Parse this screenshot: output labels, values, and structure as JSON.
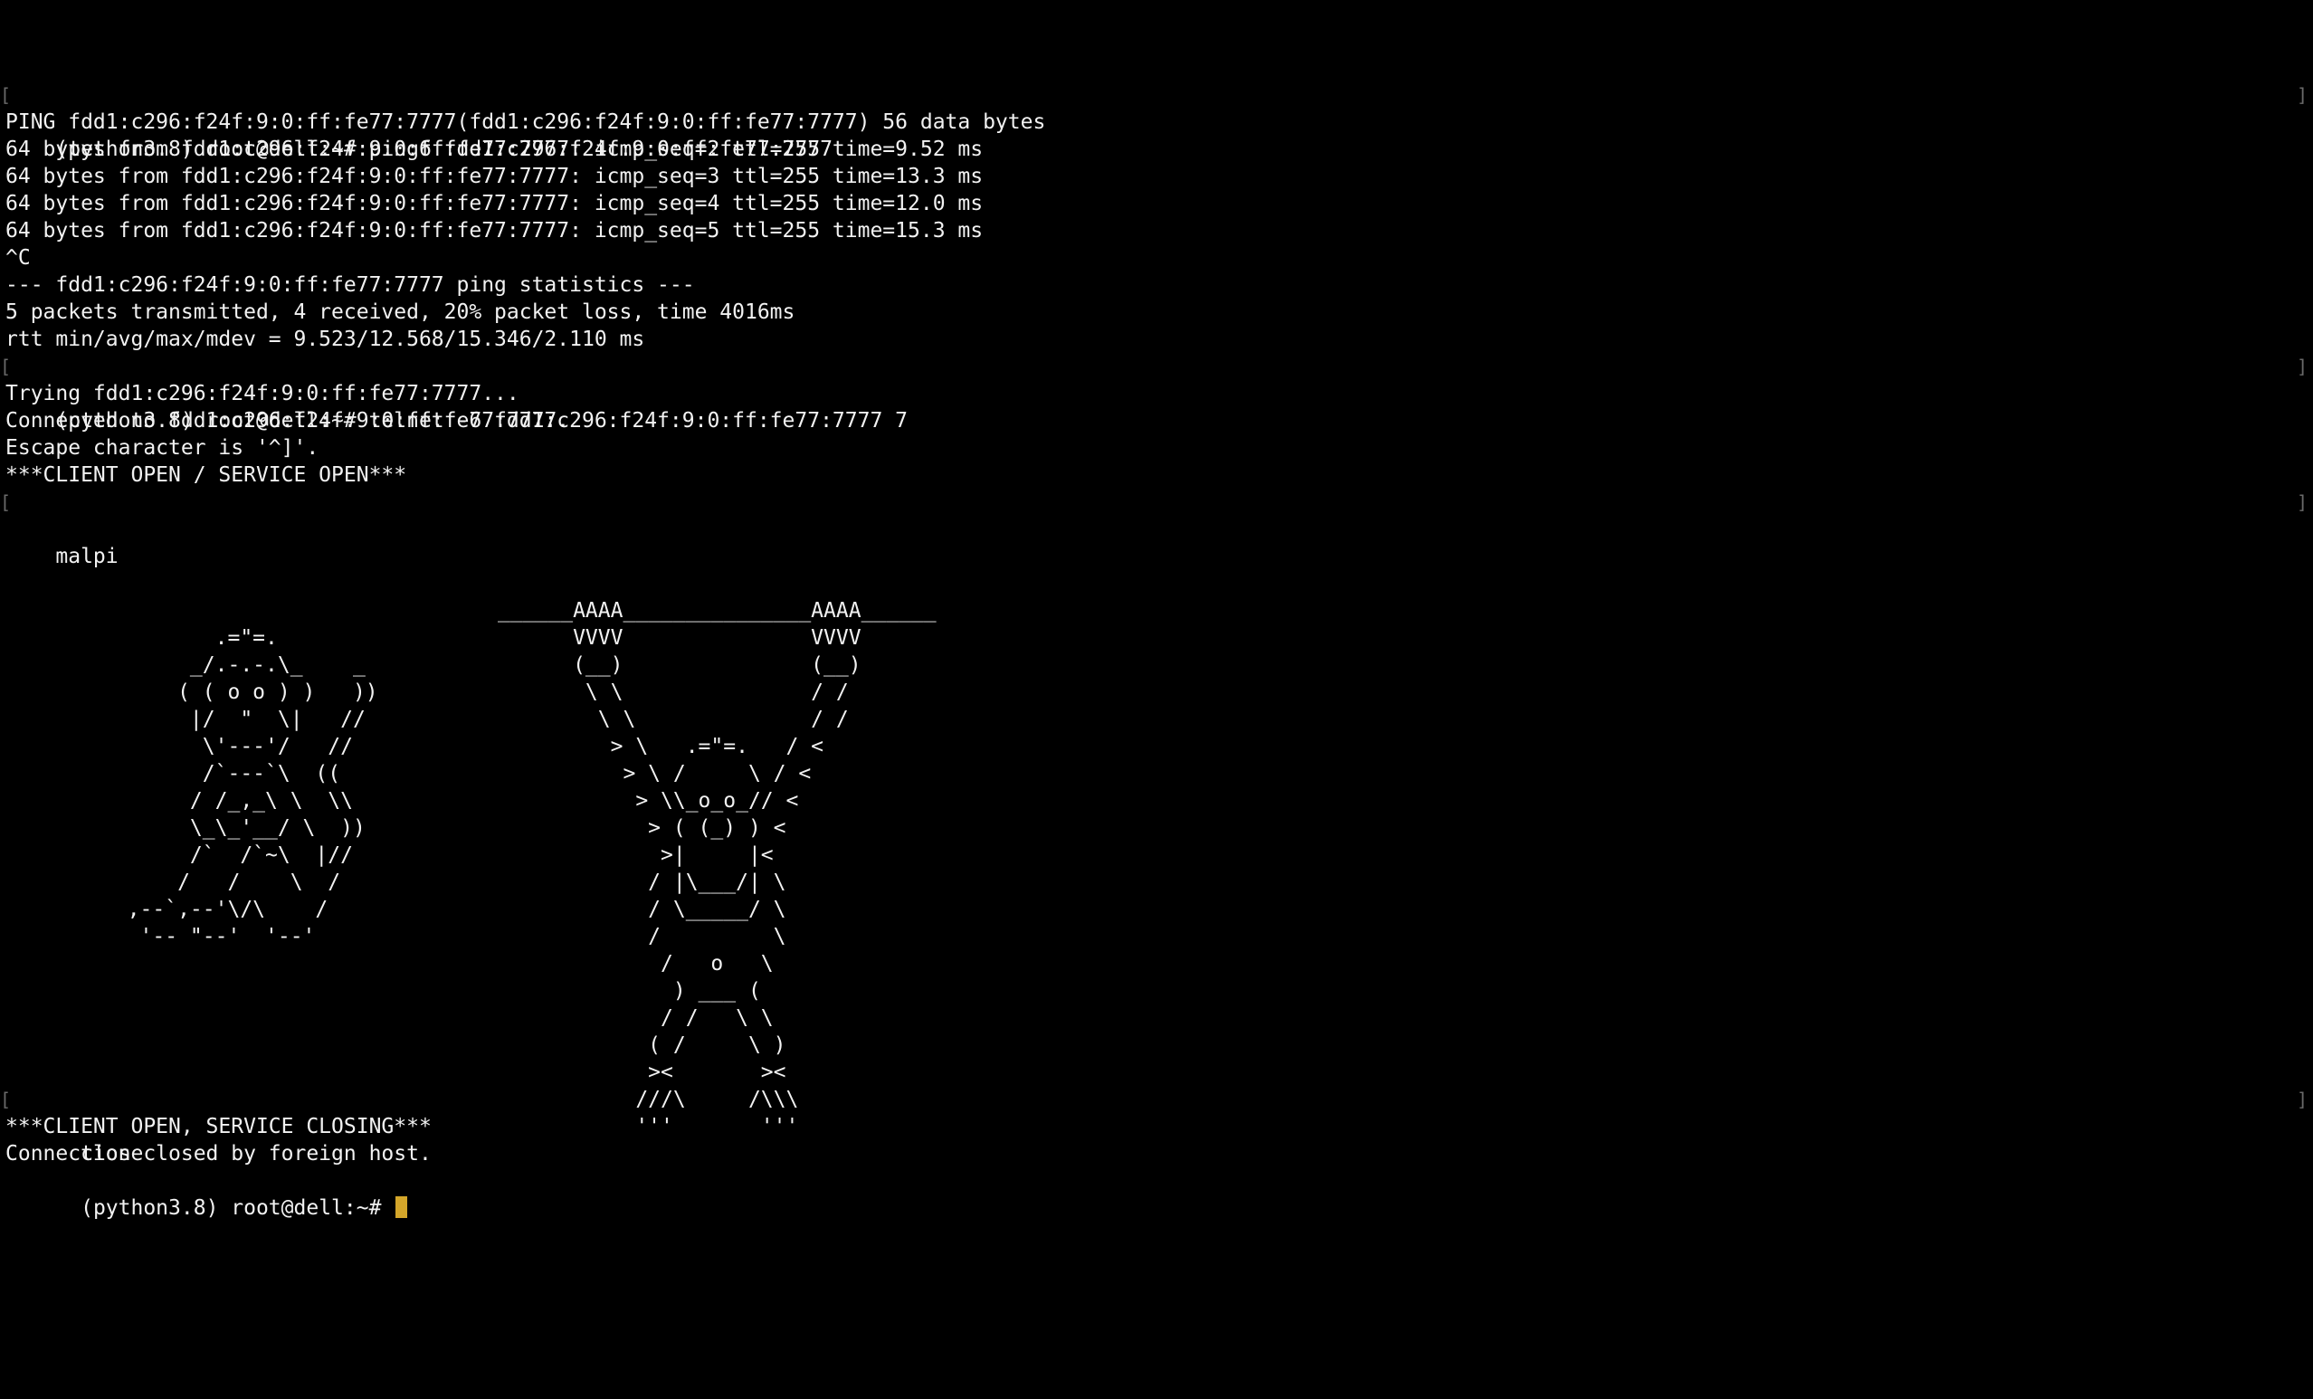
{
  "terminal": {
    "block1": [
      "(python3.8) root@dell:~# ping6 fdd1:c296:f24f:9:0:ff:fe77:7777",
      "PING fdd1:c296:f24f:9:0:ff:fe77:7777(fdd1:c296:f24f:9:0:ff:fe77:7777) 56 data bytes",
      "64 bytes from fdd1:c296:f24f:9:0:ff:fe77:7777: icmp_seq=2 ttl=255 time=9.52 ms",
      "64 bytes from fdd1:c296:f24f:9:0:ff:fe77:7777: icmp_seq=3 ttl=255 time=13.3 ms",
      "64 bytes from fdd1:c296:f24f:9:0:ff:fe77:7777: icmp_seq=4 ttl=255 time=12.0 ms",
      "64 bytes from fdd1:c296:f24f:9:0:ff:fe77:7777: icmp_seq=5 ttl=255 time=15.3 ms",
      "^C",
      "--- fdd1:c296:f24f:9:0:ff:fe77:7777 ping statistics ---",
      "5 packets transmitted, 4 received, 20% packet loss, time 4016ms",
      "rtt min/avg/max/mdev = 9.523/12.568/15.346/2.110 ms",
      "(python3.8) root@dell:~# telnet -6 fdd1:c296:f24f:9:0:ff:fe77:7777 7",
      "Trying fdd1:c296:f24f:9:0:ff:fe77:7777...",
      "Connected to fdd1:c296:f24f:9:0:ff:fe77:7777.",
      "Escape character is '^]'.",
      "***CLIENT OPEN / SERVICE OPEN***",
      "malpi"
    ],
    "art_right": "______AAAA_______________AAAA______\n      VVVV               VVVV\n      (__)               (__)\n       \\ \\               / /\n        \\ \\              / /\n         > \\   .=\"=.   / <\n          > \\ /     \\ / <\n           > \\\\_o_o_// <\n            > ( (_) ) <\n             >|     |<\n            / |\\___/| \\\n            / \\_____/ \\\n            /         \\\n             /   o   \\\n              ) ___ (\n             / /   \\ \\\n            ( /     \\ )\n            ><       ><\n           ///\\     /\\\\\\\n           '''       '''",
    "art_left": "         .=\"=.\n       _/.-.-.\\_    _\n      ( ( o o ) )   ))\n       |/  \"  \\|   //\n        \\'---'/   //\n        /`---`\\  ((\n       / /_,_\\ \\  \\\\\n       \\_\\_'__/ \\  ))\n       /`  /`~\\  |//\n      /   /    \\  /\n  ,--`,--'\\/\\    /\n   '-- \"--'  '--'",
    "block2": [
      "close",
      "***CLIENT OPEN, SERVICE CLOSING***",
      "Connection closed by foreign host.",
      "(python3.8) root@dell:~# "
    ],
    "left_marker": "[",
    "right_marker": "]",
    "colors": {
      "background": "#000000",
      "foreground": "#f2f2f2",
      "cursor": "#d4a62a",
      "marker": "#6a6a6a"
    }
  }
}
